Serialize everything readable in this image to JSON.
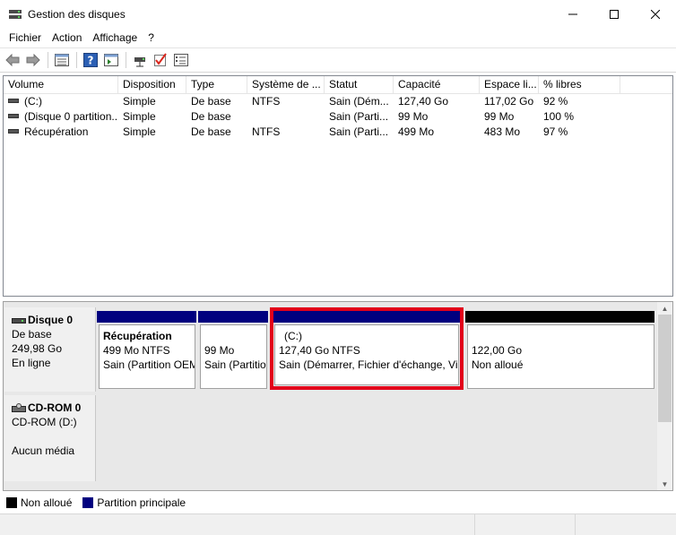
{
  "window": {
    "title": "Gestion des disques"
  },
  "menu": {
    "items": [
      "Fichier",
      "Action",
      "Affichage",
      "?"
    ]
  },
  "toolbar": {
    "icons": [
      "back-icon",
      "forward-icon",
      "disk-list-icon",
      "help-icon",
      "console-icon",
      "connect-icon",
      "check-icon",
      "properties-icon"
    ]
  },
  "volume_list": {
    "columns": [
      "Volume",
      "Disposition",
      "Type",
      "Système de ...",
      "Statut",
      "Capacité",
      "Espace li...",
      "% libres"
    ],
    "rows": [
      [
        "(C:)",
        "Simple",
        "De base",
        "NTFS",
        "Sain (Dém...",
        "127,40 Go",
        "117,02 Go",
        "92 %"
      ],
      [
        "(Disque 0 partition...",
        "Simple",
        "De base",
        "",
        "Sain (Parti...",
        "99 Mo",
        "99 Mo",
        "100 %"
      ],
      [
        "Récupération",
        "Simple",
        "De base",
        "NTFS",
        "Sain (Parti...",
        "499 Mo",
        "483 Mo",
        "97 %"
      ]
    ]
  },
  "disks": [
    {
      "name": "Disque 0",
      "type": "De base",
      "size": "249,98 Go",
      "status": "En ligne",
      "partitions": [
        {
          "name": "Récupération",
          "size": "499 Mo NTFS",
          "status": "Sain (Partition OEM"
        },
        {
          "name": "",
          "size": "99 Mo",
          "status": "Sain (Partitio"
        },
        {
          "name": "(C:)",
          "size": "127,40 Go NTFS",
          "status": "Sain (Démarrer, Fichier d'échange, Vic"
        },
        {
          "name": "",
          "size": "122,00 Go",
          "status": "Non alloué"
        }
      ]
    },
    {
      "name": "CD-ROM 0",
      "type": "CD-ROM (D:)",
      "size": "",
      "status": "Aucun média"
    }
  ],
  "legend": [
    {
      "label": "Non alloué",
      "color": "#000000"
    },
    {
      "label": "Partition principale",
      "color": "#00007f"
    }
  ]
}
